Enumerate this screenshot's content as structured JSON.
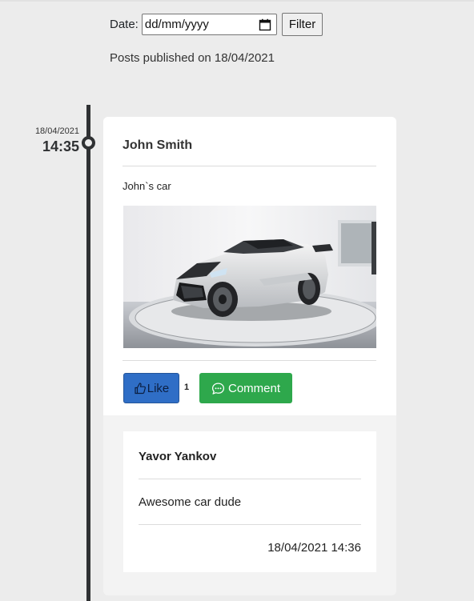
{
  "filter": {
    "label": "Date:",
    "date_placeholder": "dd/mm/yyyy",
    "button_label": "Filter"
  },
  "posts_heading": "Posts published on 18/04/2021",
  "timeline": {
    "date": "18/04/2021",
    "time": "14:35"
  },
  "post": {
    "author": "John Smith",
    "text": "John`s car",
    "image_subject": "white sports car on turntable",
    "like_label": "Like",
    "like_count": "1",
    "comment_label": "Comment",
    "like_color": "#2f6ec6",
    "comment_color": "#2ea84c"
  },
  "comments": [
    {
      "author": "Yavor Yankov",
      "text": "Awesome car dude",
      "timestamp": "18/04/2021 14:36"
    }
  ]
}
